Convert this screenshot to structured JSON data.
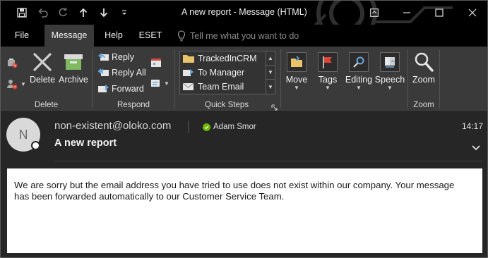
{
  "window": {
    "title": "A new report  -  Message (HTML)"
  },
  "menu": {
    "tabs": [
      {
        "label": "File"
      },
      {
        "label": "Message"
      },
      {
        "label": "Help"
      },
      {
        "label": "ESET"
      }
    ],
    "active_tab": "Message",
    "tell_me_placeholder": "Tell me what you want to do"
  },
  "ribbon": {
    "delete_group": {
      "label": "Delete",
      "delete_label": "Delete",
      "archive_label": "Archive"
    },
    "respond_group": {
      "label": "Respond",
      "reply_label": "Reply",
      "reply_all_label": "Reply All",
      "forward_label": "Forward"
    },
    "quick_steps_group": {
      "label": "Quick Steps",
      "items": [
        {
          "label": "TrackedInCRM"
        },
        {
          "label": "To Manager"
        },
        {
          "label": "Team Email"
        }
      ]
    },
    "move_group": {
      "move_label": "Move"
    },
    "tags_group": {
      "tags_label": "Tags"
    },
    "editing_group": {
      "editing_label": "Editing"
    },
    "speech_group": {
      "speech_label": "Speech"
    },
    "zoom_group": {
      "label": "Zoom",
      "zoom_label": "Zoom"
    }
  },
  "message": {
    "avatar_initial": "N",
    "sender": "non-existent@oloko.com",
    "recipient": "Adam Smor",
    "subject": "A new report",
    "time": "14:17",
    "body_line_1": "We are sorry but the email address you have tried to use does not exist within our company. Your message",
    "body_line_2": "has been forwarded automatically to our Customer Service Team."
  },
  "colors": {
    "titlebar": "#000000",
    "ribbon": "#3a3a3a",
    "background": "#262626",
    "presence_ok": "#6bb700",
    "tags_flag": "#e0433a"
  }
}
